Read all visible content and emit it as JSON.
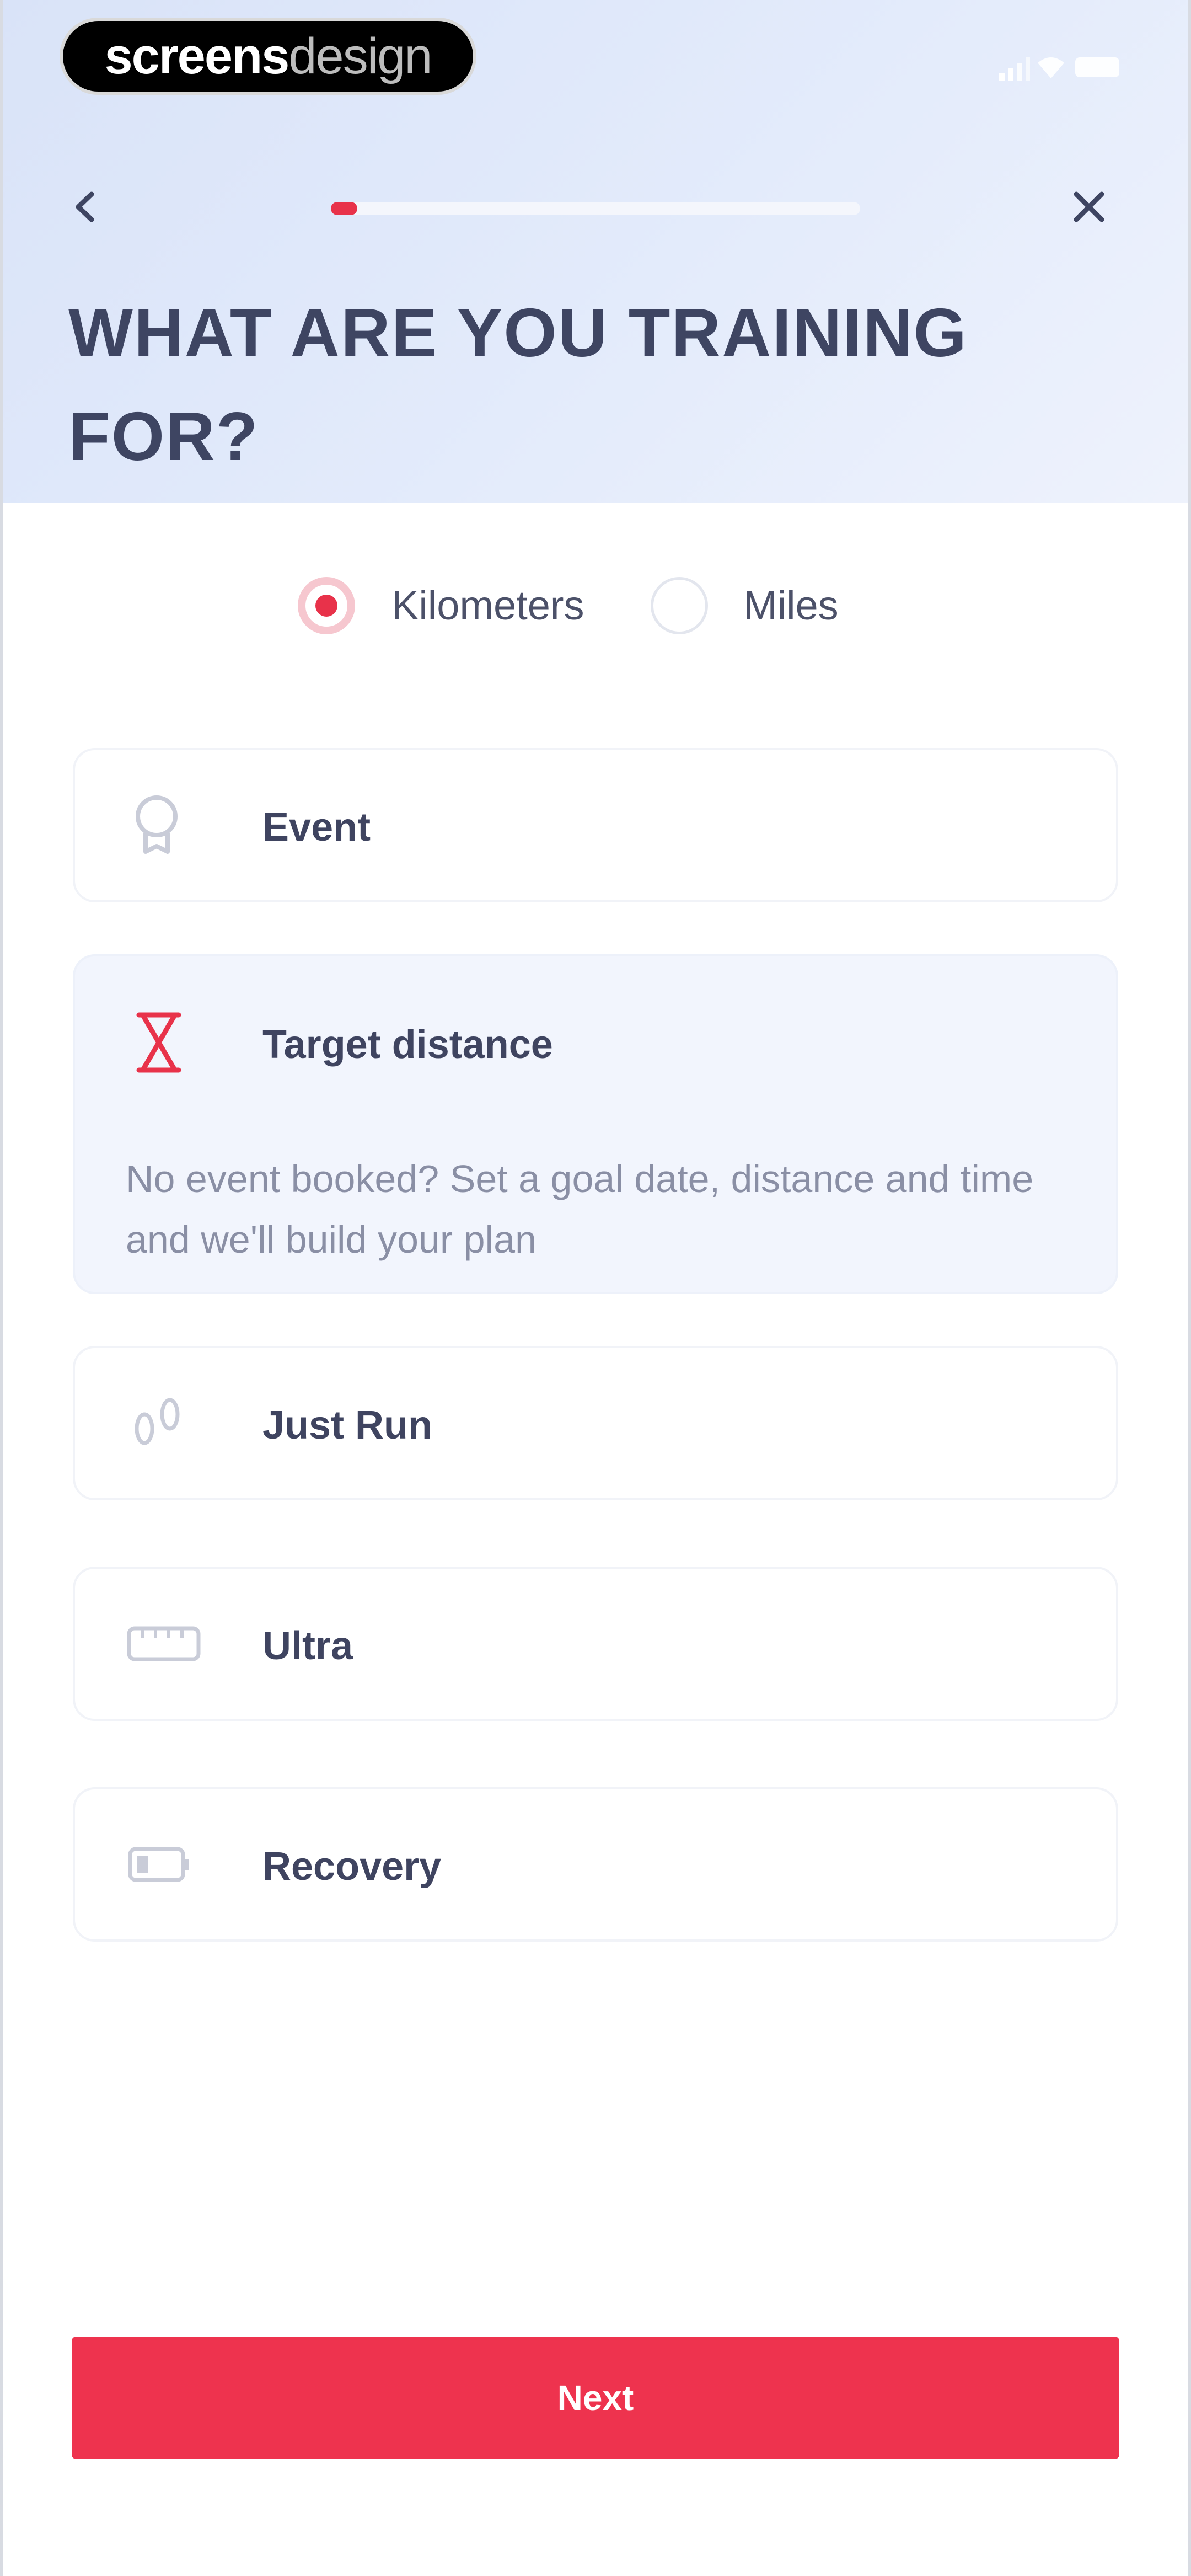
{
  "watermark": {
    "part1": "screens",
    "part2": "design"
  },
  "status_bar": {
    "icons": [
      "signal-icon",
      "wifi-icon",
      "battery-icon"
    ]
  },
  "nav": {
    "back_icon": "chevron-left-icon",
    "close_icon": "close-icon",
    "progress": 0.05
  },
  "title": "WHAT ARE YOU TRAINING FOR?",
  "units": {
    "options": [
      {
        "label": "Kilometers",
        "selected": true
      },
      {
        "label": "Miles",
        "selected": false
      }
    ]
  },
  "options": [
    {
      "label": "Event",
      "icon": "medal-icon",
      "selected": false
    },
    {
      "label": "Target distance",
      "icon": "hourglass-icon",
      "selected": true,
      "description": "No event booked? Set a goal date, distance and time and we'll build your plan"
    },
    {
      "label": "Just Run",
      "icon": "footprints-icon",
      "selected": false
    },
    {
      "label": "Ultra",
      "icon": "ruler-icon",
      "selected": false
    },
    {
      "label": "Recovery",
      "icon": "battery-low-icon",
      "selected": false
    }
  ],
  "next_label": "Next",
  "colors": {
    "accent": "#ee334e",
    "header_bg": "#dfe8fa",
    "text": "#3e4562"
  }
}
